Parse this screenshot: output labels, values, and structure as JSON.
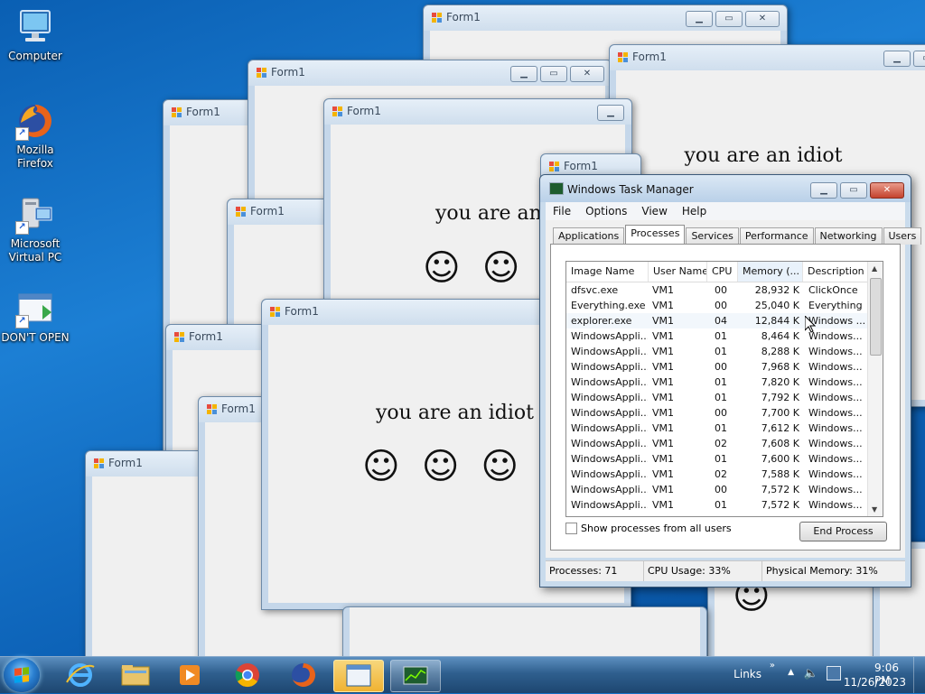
{
  "desktop": {
    "icons": [
      {
        "label": "Computer"
      },
      {
        "label": "Mozilla Firefox"
      },
      {
        "label": "Microsoft Virtual PC"
      },
      {
        "label": "DON'T OPEN"
      }
    ]
  },
  "forms": {
    "title": "Form1",
    "message": "you are an idiot",
    "message_partial": "you are an i",
    "smiley": "☺"
  },
  "taskmgr": {
    "title": "Windows Task Manager",
    "menu": [
      "File",
      "Options",
      "View",
      "Help"
    ],
    "tabs": [
      "Applications",
      "Processes",
      "Services",
      "Performance",
      "Networking",
      "Users"
    ],
    "active_tab": "Processes",
    "columns": [
      "Image Name",
      "User Name",
      "CPU",
      "Memory (...",
      "Description"
    ],
    "rows": [
      [
        "dfsvc.exe",
        "VM1",
        "00",
        "28,932 K",
        "ClickOnce"
      ],
      [
        "Everything.exe",
        "VM1",
        "00",
        "25,040 K",
        "Everything"
      ],
      [
        "explorer.exe",
        "VM1",
        "04",
        "12,844 K",
        "Windows ..."
      ],
      [
        "WindowsAppli...",
        "VM1",
        "01",
        "8,464 K",
        "Windows..."
      ],
      [
        "WindowsAppli...",
        "VM1",
        "01",
        "8,288 K",
        "Windows..."
      ],
      [
        "WindowsAppli...",
        "VM1",
        "00",
        "7,968 K",
        "Windows..."
      ],
      [
        "WindowsAppli...",
        "VM1",
        "01",
        "7,820 K",
        "Windows..."
      ],
      [
        "WindowsAppli...",
        "VM1",
        "01",
        "7,792 K",
        "Windows..."
      ],
      [
        "WindowsAppli...",
        "VM1",
        "00",
        "7,700 K",
        "Windows..."
      ],
      [
        "WindowsAppli...",
        "VM1",
        "01",
        "7,612 K",
        "Windows..."
      ],
      [
        "WindowsAppli...",
        "VM1",
        "02",
        "7,608 K",
        "Windows..."
      ],
      [
        "WindowsAppli...",
        "VM1",
        "01",
        "7,600 K",
        "Windows..."
      ],
      [
        "WindowsAppli...",
        "VM1",
        "02",
        "7,588 K",
        "Windows..."
      ],
      [
        "WindowsAppli...",
        "VM1",
        "00",
        "7,572 K",
        "Windows..."
      ],
      [
        "WindowsAppli...",
        "VM1",
        "01",
        "7,572 K",
        "Windows..."
      ]
    ],
    "show_all_label": "Show processes from all users",
    "end_process_label": "End Process",
    "status": {
      "processes": "Processes: 71",
      "cpu": "CPU Usage: 33%",
      "memory": "Physical Memory: 31%"
    }
  },
  "taskbar": {
    "links_label": "Links",
    "time": "9:06 PM",
    "date": "11/26/2023"
  },
  "colors": {
    "accent": "#1c7fd4",
    "taskbar": "#2f5f8e",
    "active_button": "#f0b232"
  }
}
